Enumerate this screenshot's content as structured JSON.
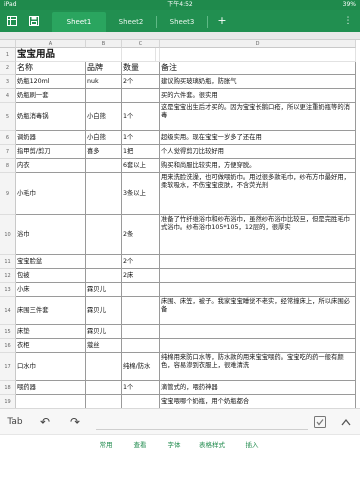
{
  "status_bar": {
    "carrier": "iPad",
    "time": "下午4:52",
    "battery": "39%"
  },
  "tab_bar": {
    "sheets": [
      "Sheet1",
      "Sheet2",
      "Sheet3"
    ],
    "active_sheet": "Sheet1",
    "add_symbol": "+",
    "more_symbol": "⋮"
  },
  "columns": [
    "A",
    "B",
    "C",
    "D"
  ],
  "rows": [
    {
      "n": "1",
      "a": "宝宝用品",
      "b": "",
      "c": "",
      "d": ""
    },
    {
      "n": "2",
      "a": "名称",
      "b": "品牌",
      "c": "数量",
      "d": "备注"
    },
    {
      "n": "3",
      "a": "奶瓶120ml",
      "b": "nuk",
      "c": "2个",
      "d": "建议购买玻璃奶瓶，防胀气"
    },
    {
      "n": "4",
      "a": "奶瓶刷一套",
      "b": "",
      "c": "",
      "d": "买的六件套。很实用"
    },
    {
      "n": "5",
      "a": "奶瓶消毒锅",
      "b": "小白熊",
      "c": "1个",
      "d": "这是宝宝出生后才买的。因为宝宝长鹅口疮，所以更注重奶瓶等的消毒"
    },
    {
      "n": "6",
      "a": "调奶器",
      "b": "小白熊",
      "c": "1个",
      "d": "超级实用。现在宝宝一岁多了还在用"
    },
    {
      "n": "7",
      "a": "指甲剪/剪刀",
      "b": "喜多",
      "c": "1把",
      "d": "个人觉得剪刀比较好用"
    },
    {
      "n": "8",
      "a": "内衣",
      "b": "",
      "c": "6套以上",
      "d": "购买和尚服比较实用，方便穿脱。"
    },
    {
      "n": "9",
      "a": "小毛巾",
      "b": "",
      "c": "3条以上",
      "d": "用来洗脸洗澡，也可做喂奶巾。用过很多款毛巾，纱布方巾最好用，柔软吸水，不伤宝宝皮肤，不含荧光剂"
    },
    {
      "n": "10",
      "a": "浴巾",
      "b": "",
      "c": "2条",
      "d": "准备了竹纤维浴巾和纱布浴巾，虽然纱布浴巾比较旦，但是完胜毛巾式浴巾。纱布浴巾105*105，12层的，很厚实"
    },
    {
      "n": "11",
      "a": "宝宝脸盆",
      "b": "",
      "c": "2个",
      "d": ""
    },
    {
      "n": "12",
      "a": "包被",
      "b": "",
      "c": "2床",
      "d": ""
    },
    {
      "n": "13",
      "a": "小床",
      "b": "霖贝儿",
      "c": "",
      "d": ""
    },
    {
      "n": "14",
      "a": "床围三件套",
      "b": "霖贝儿",
      "c": "",
      "d": "床围、床笠，被子。我家宝宝睡觉不老实，经常撞床上，所以床围必备"
    },
    {
      "n": "15",
      "a": "床垫",
      "b": "霖贝儿",
      "c": "",
      "d": ""
    },
    {
      "n": "16",
      "a": "衣柜",
      "b": "蔻丝",
      "c": "",
      "d": ""
    },
    {
      "n": "17",
      "a": "口水巾",
      "b": "",
      "c": "纯棉/防水",
      "d": "纯棉用来防口水等，防水款的用来宝宝喂药。宝宝吃的药一般有颜色，容易渗到衣服上，很难清洗"
    },
    {
      "n": "18",
      "a": "喂药器",
      "b": "",
      "c": "1个",
      "d": "滴管式的，喂药神器"
    },
    {
      "n": "19",
      "a": "",
      "b": "",
      "c": "",
      "d": "宝宝喂哪个奶瓶，用个奶瓶都合"
    }
  ],
  "bottom_toolbar": {
    "tab": "Tab",
    "undo": "↶",
    "redo": "↷",
    "ok": "✓"
  },
  "menu": [
    "常用",
    "查看",
    "字体",
    "表格样式",
    "插入"
  ],
  "colors": {
    "brand_green": "#1f8a4c",
    "active_tab": "#2aa55f"
  }
}
